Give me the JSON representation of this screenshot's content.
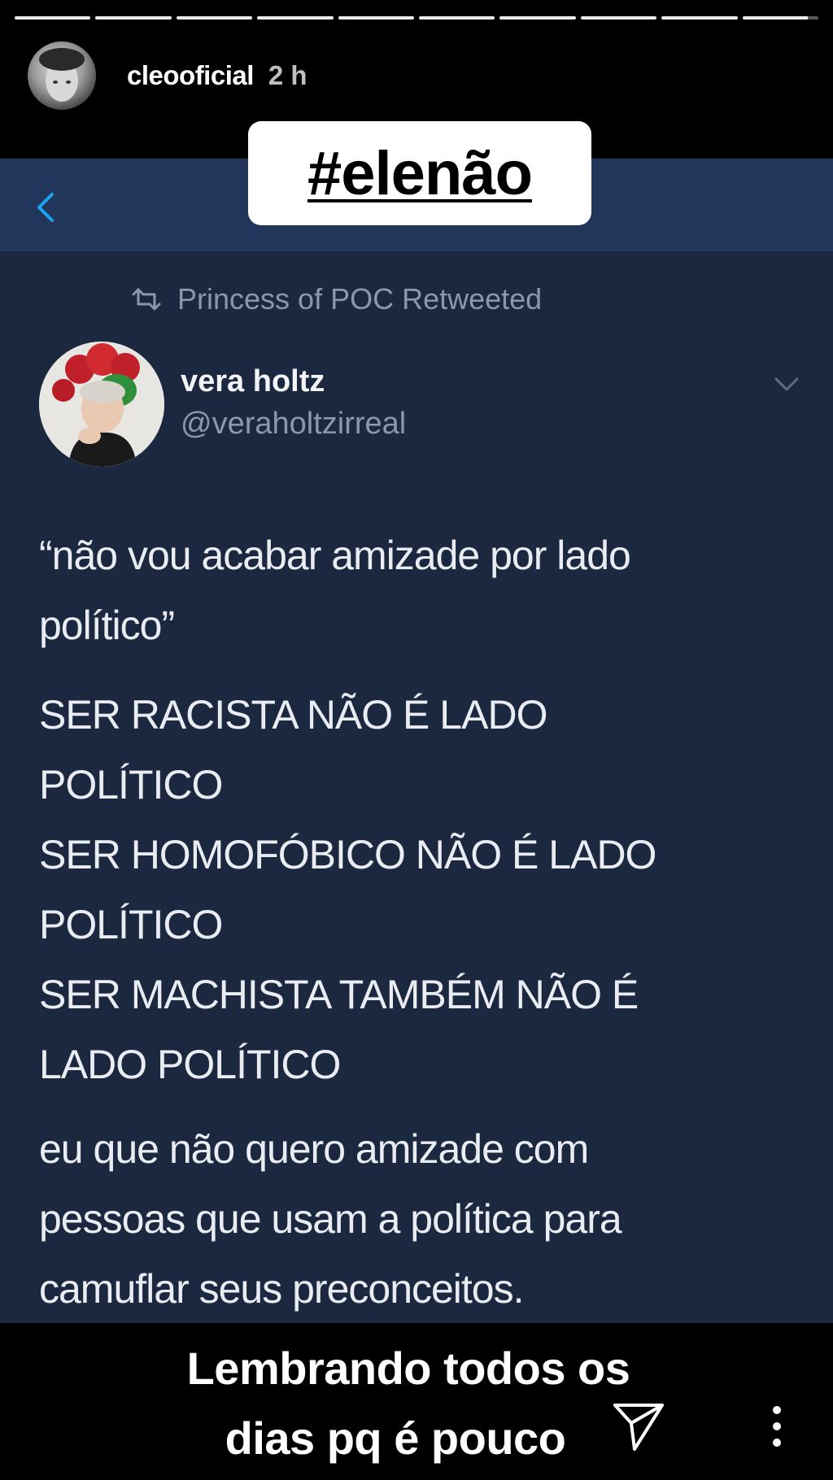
{
  "story": {
    "segments": 10,
    "current_segment_progress": 0.86
  },
  "header": {
    "username": "cleooficial",
    "time": "2 h",
    "avatar_icon": "profile-photo"
  },
  "sticker": {
    "hashtag": "#elenão"
  },
  "tweet": {
    "retweeted_by": "Princess of POC Retweeted",
    "author_name": "vera holtz",
    "author_handle": "@veraholtzirreal",
    "paragraph1": [
      "“não vou acabar amizade por lado",
      "político”"
    ],
    "paragraph2": [
      "SER RACISTA NÃO É LADO",
      "POLÍTICO",
      "SER HOMOFÓBICO NÃO É LADO",
      "POLÍTICO",
      "SER MACHISTA TAMBÉM NÃO É",
      "LADO POLÍTICO"
    ],
    "paragraph3": [
      "eu que não quero amizade com",
      "pessoas que usam a política para",
      "camuflar seus preconceitos."
    ]
  },
  "caption": {
    "line1": "Lembrando todos os",
    "line2": "dias pq é pouco"
  },
  "colors": {
    "tweet_bg": "#1c283f",
    "topbar_bg": "#22355a",
    "accent_blue": "#1da1f2",
    "muted_text": "#8b98ab"
  }
}
